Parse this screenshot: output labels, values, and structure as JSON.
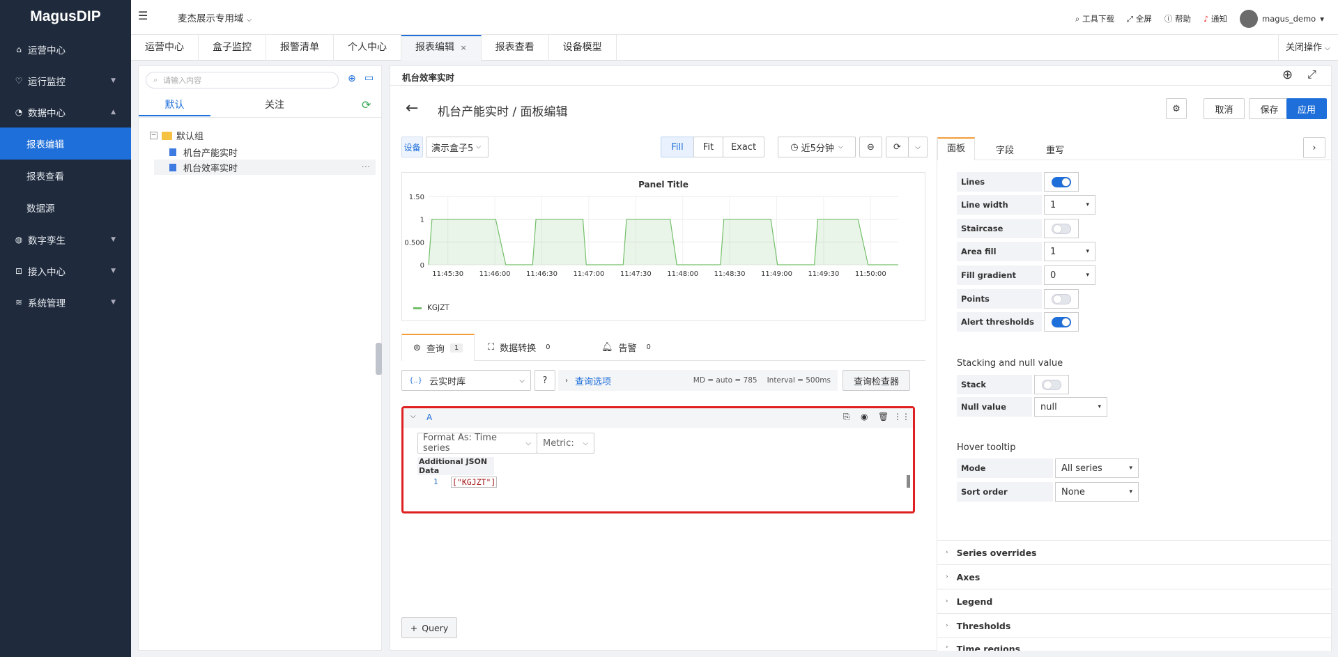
{
  "app": {
    "logo": "MagusDIP",
    "domain": "麦杰展示专用域"
  },
  "header": {
    "tools": "工具下载",
    "fullscreen": "全屏",
    "help": "帮助",
    "notify": "通知",
    "user": "magus_demo"
  },
  "sidebar": {
    "items": [
      {
        "label": "运营中心",
        "icon": "home-icon"
      },
      {
        "label": "运行监控",
        "icon": "bulb-icon"
      },
      {
        "label": "数据中心",
        "icon": "chart-icon"
      },
      {
        "label": "报表编辑"
      },
      {
        "label": "报表查看"
      },
      {
        "label": "数据源"
      },
      {
        "label": "数字孪生",
        "icon": "globe-icon"
      },
      {
        "label": "接入中心",
        "icon": "import-icon"
      },
      {
        "label": "系统管理",
        "icon": "layers-icon"
      }
    ]
  },
  "tabs": [
    "运营中心",
    "盒子监控",
    "报警清单",
    "个人中心",
    "报表编辑",
    "报表查看",
    "设备模型"
  ],
  "close_ops": "关闭操作",
  "tree": {
    "search_placeholder": "请输入内容",
    "tab_default": "默认",
    "tab_follow": "关注",
    "group": "默认组",
    "items": [
      "机台产能实时",
      "机台效率实时"
    ]
  },
  "panel": {
    "window_title": "机台效率实时",
    "page_title": "机台产能实时 / 面板编辑",
    "cancel": "取消",
    "save": "保存",
    "apply": "应用",
    "device_label": "设备",
    "device_value": "演示盒子5",
    "fill": "Fill",
    "fit": "Fit",
    "exact": "Exact",
    "time_range": "近5分钟"
  },
  "chart_data": {
    "type": "line",
    "title": "Panel Title",
    "legend": "KGJZT",
    "x": [
      "11:45:30",
      "11:46:00",
      "11:46:30",
      "11:47:00",
      "11:47:30",
      "11:48:00",
      "11:48:30",
      "11:49:00",
      "11:49:30",
      "11:50:00"
    ],
    "yticks": [
      "1.50",
      "1",
      "0.500",
      "0"
    ],
    "ylim": [
      0,
      1.5
    ],
    "series": [
      {
        "name": "KGJZT",
        "color": "#73bf69",
        "points": [
          [
            0,
            0
          ],
          [
            1,
            1
          ],
          [
            20,
            1
          ],
          [
            23,
            0
          ],
          [
            31,
            0
          ],
          [
            32,
            1
          ],
          [
            46,
            1
          ],
          [
            47,
            0
          ],
          [
            58,
            0
          ],
          [
            59,
            1
          ],
          [
            72,
            1
          ],
          [
            74,
            0
          ],
          [
            87,
            0
          ],
          [
            88,
            1
          ],
          [
            102,
            1
          ],
          [
            104,
            0
          ],
          [
            115,
            0
          ],
          [
            116,
            1
          ],
          [
            128,
            1
          ],
          [
            131,
            0
          ],
          [
            140,
            0
          ]
        ]
      }
    ]
  },
  "query": {
    "tab_query": "查询",
    "tab_query_count": "1",
    "tab_transform": "数据转换",
    "tab_transform_count": "0",
    "tab_alert": "告警",
    "tab_alert_count": "0",
    "datasource": "云实时库",
    "options": "查询选项",
    "md": "MD = auto = 785",
    "interval": "Interval = 500ms",
    "inspector": "查询检查器",
    "row_name": "A",
    "format": "Format As: Time series",
    "metric": "Metric:",
    "json_label": "Additional JSON Data",
    "line_no": "1",
    "code": "[\"KGJZT\"]",
    "add_query": "Query"
  },
  "options": {
    "tabs": [
      "面板",
      "字段",
      "重写"
    ],
    "rows": [
      {
        "label": "Lines"
      },
      {
        "label": "Line width",
        "value": "1"
      },
      {
        "label": "Staircase"
      },
      {
        "label": "Area fill",
        "value": "1"
      },
      {
        "label": "Fill gradient",
        "value": "0"
      },
      {
        "label": "Points"
      },
      {
        "label": "Alert thresholds"
      }
    ],
    "stacking_title": "Stacking and null value",
    "stack": "Stack",
    "null_value": "Null value",
    "null_value_val": "null",
    "hover_title": "Hover tooltip",
    "mode": "Mode",
    "mode_val": "All series",
    "sort": "Sort order",
    "sort_val": "None",
    "sections": [
      "Series overrides",
      "Axes",
      "Legend",
      "Thresholds",
      "Time regions"
    ]
  }
}
